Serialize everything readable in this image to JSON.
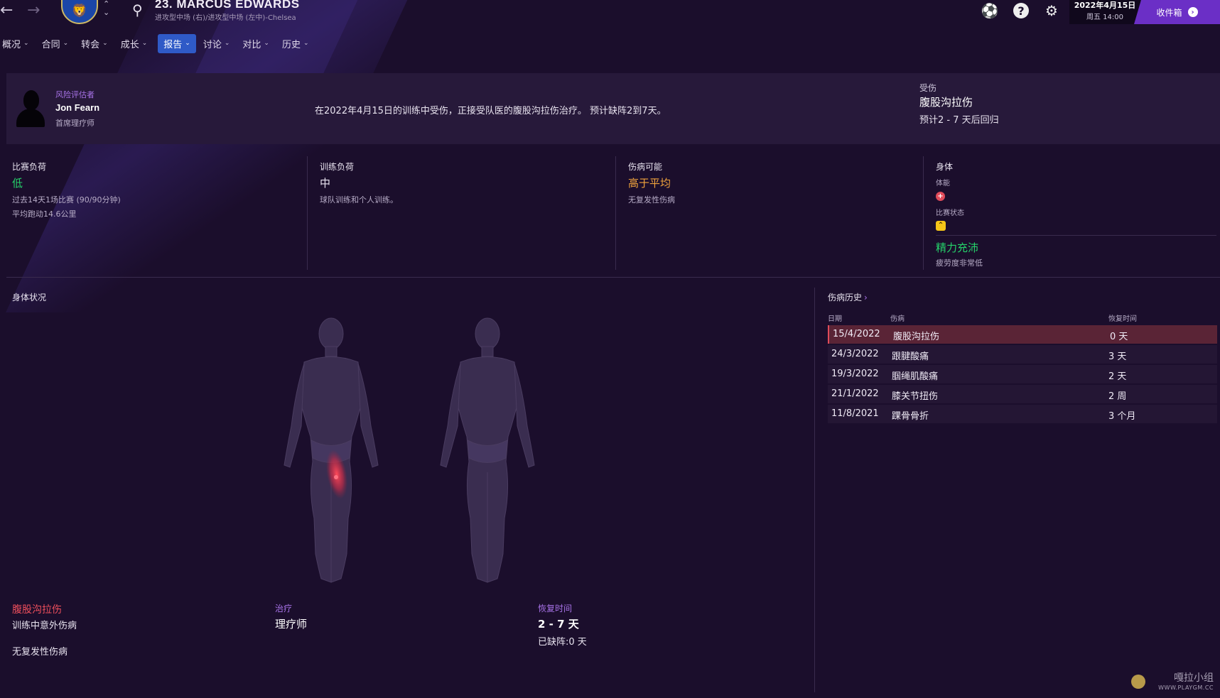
{
  "header": {
    "player_name": "23. MARCUS EDWARDS",
    "player_subtitle": "进攻型中场 (右)/进攻型中场 (左中)-Chelsea",
    "date": "2022年4月15日",
    "day_time": "周五 14:00",
    "inbox_label": "收件箱"
  },
  "menu": {
    "items": [
      {
        "label": "概况"
      },
      {
        "label": "合同"
      },
      {
        "label": "转会"
      },
      {
        "label": "成长"
      },
      {
        "label": "报告",
        "active": true
      },
      {
        "label": "讨论"
      },
      {
        "label": "对比"
      },
      {
        "label": "历史"
      }
    ]
  },
  "advisor": {
    "role": "风险评估者",
    "name": "Jon Fearn",
    "title": "首席理疗师",
    "message": "在2022年4月15日的训练中受伤，正接受队医的腹股沟拉伤治疗。 预计缺阵2到7天。",
    "injury_heading": "受伤",
    "injury_name": "腹股沟拉伤",
    "injury_return": "预计2 - 7 天后回归"
  },
  "stats": {
    "match_load": {
      "heading": "比赛负荷",
      "value": "低",
      "detail1": "过去14天1场比赛 (90/90分钟)",
      "detail2": "平均跑动14.6公里"
    },
    "training_load": {
      "heading": "训练负荷",
      "value": "中",
      "detail1": "球队训练和个人训练。"
    },
    "injury_proneness": {
      "heading": "伤病可能",
      "value": "高于平均",
      "detail1": "无复发性伤病"
    },
    "physical": {
      "heading": "身体",
      "fitness_label": "体能",
      "form_label": "比赛状态",
      "value": "精力充沛",
      "detail1": "疲劳度非常低"
    }
  },
  "physical_condition": {
    "title": "身体状况",
    "injury_name": "腹股沟拉伤",
    "injury_type": "训练中意外伤病",
    "recurrence": "无复发性伤病",
    "treatment_heading": "治疗",
    "treatment_value": "理疗师",
    "recovery_heading": "恢复时间",
    "recovery_value": "2 - 7 天",
    "missed": "已缺阵:0 天"
  },
  "history": {
    "title": "伤病历史",
    "columns": [
      "日期",
      "伤病",
      "恢复时间"
    ],
    "rows": [
      [
        "15/4/2022",
        "腹股沟拉伤",
        "0 天"
      ],
      [
        "24/3/2022",
        "跟腱酸痛",
        "3 天"
      ],
      [
        "19/3/2022",
        "腘绳肌酸痛",
        "2 天"
      ],
      [
        "21/1/2022",
        "膝关节扭伤",
        "2 周"
      ],
      [
        "11/8/2021",
        "踝骨骨折",
        "3 个月"
      ]
    ]
  },
  "watermark": {
    "title": "嘎拉小组",
    "url": "WWW.PLAYGM.CC"
  },
  "colors": {
    "accent": "#2f5ac7",
    "injury": "#ef4f5c",
    "good": "#25d36a",
    "warning": "#f0a33c",
    "inbox": "#6b2fc6"
  },
  "icons": {
    "back": "arrow-left",
    "forward": "arrow-right",
    "search": "search",
    "settings": "gear",
    "help": "question"
  }
}
